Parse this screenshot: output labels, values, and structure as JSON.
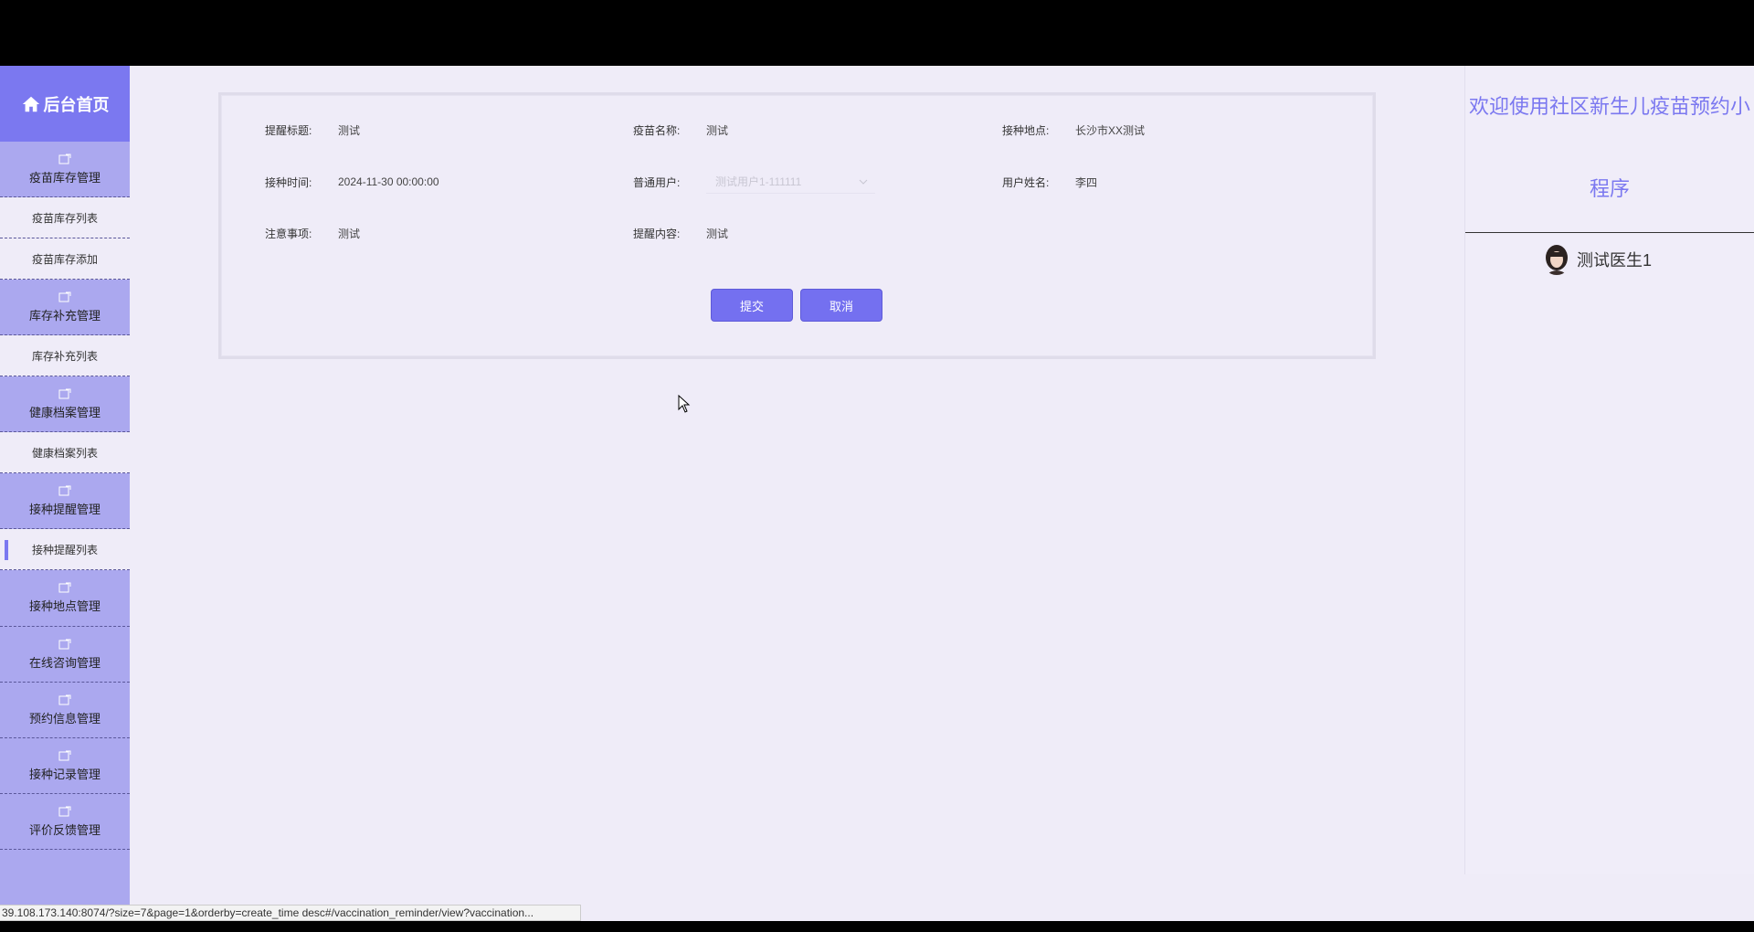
{
  "sidebar": {
    "home_label": "后台首页",
    "groups": [
      {
        "label": "疫苗库存管理",
        "subs": [
          "疫苗库存列表",
          "疫苗库存添加"
        ]
      },
      {
        "label": "库存补充管理",
        "subs": [
          "库存补充列表"
        ]
      },
      {
        "label": "健康档案管理",
        "subs": [
          "健康档案列表"
        ]
      },
      {
        "label": "接种提醒管理",
        "subs": [
          "接种提醒列表"
        ]
      },
      {
        "label": "接种地点管理",
        "subs": []
      },
      {
        "label": "在线咨询管理",
        "subs": []
      },
      {
        "label": "预约信息管理",
        "subs": []
      },
      {
        "label": "接种记录管理",
        "subs": []
      },
      {
        "label": "评价反馈管理",
        "subs": []
      }
    ]
  },
  "form": {
    "reminder_title_label": "提醒标题:",
    "reminder_title_value": "测试",
    "vaccine_name_label": "疫苗名称:",
    "vaccine_name_value": "测试",
    "location_label": "接种地点:",
    "location_value": "长沙市XX测试",
    "time_label": "接种时间:",
    "time_value": "2024-11-30 00:00:00",
    "user_label": "普通用户:",
    "user_value": "测试用户1-111111",
    "username_label": "用户姓名:",
    "username_value": "李四",
    "notes_label": "注意事项:",
    "notes_value": "测试",
    "content_label": "提醒内容:",
    "content_value": "测试",
    "submit_label": "提交",
    "cancel_label": "取消"
  },
  "right": {
    "welcome_line1": "欢迎使用社区新生儿疫苗预约小",
    "welcome_line2": "程序",
    "user_name": "测试医生1"
  },
  "status_url": "39.108.173.140:8074/?size=7&page=1&orderby=create_time desc#/vaccination_reminder/view?vaccination...",
  "colors": {
    "accent": "#7b78f0",
    "sidebar": "#aba8ef",
    "background": "#efecf8"
  }
}
